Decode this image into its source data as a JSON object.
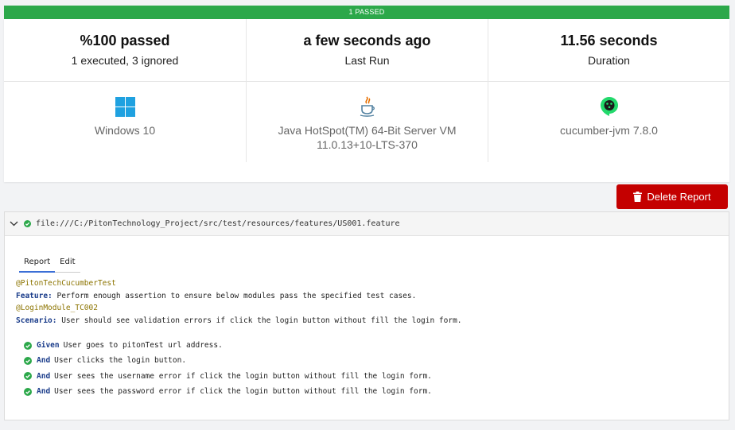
{
  "banner": {
    "text": "1 PASSED",
    "color": "#2ca84a"
  },
  "summary": {
    "passed": {
      "value": "%100 passed",
      "caption": "1 executed, 3 ignored"
    },
    "last_run": {
      "value": "a few seconds ago",
      "caption": "Last Run"
    },
    "duration": {
      "value": "11.56 seconds",
      "caption": "Duration"
    }
  },
  "environment": {
    "os": {
      "icon": "windows-icon",
      "label": "Windows 10"
    },
    "java": {
      "icon": "java-icon",
      "line1": "Java HotSpot(TM) 64-Bit Server VM",
      "line2": "11.0.13+10-LTS-370"
    },
    "runner": {
      "icon": "cucumber-icon",
      "label": "cucumber-jvm 7.8.0"
    }
  },
  "actions": {
    "delete_label": "Delete Report",
    "delete_color": "#c40000"
  },
  "feature": {
    "path": "file:///C:/PitonTechnology_Project/src/test/resources/features/US001.feature",
    "tabs": [
      {
        "label": "Report"
      },
      {
        "label": "Edit"
      }
    ],
    "feature_tag": "@PitonTechCucumberTest",
    "feature_keyword": "Feature:",
    "feature_text": " Perform enough assertion to ensure below modules pass the specified test cases.",
    "scenario_tag": "@LoginModule_TC002",
    "scenario_keyword": "Scenario:",
    "scenario_text": " User should see validation errors if click the login button without fill the login form.",
    "steps": [
      {
        "keyword": "Given",
        "text": "User goes to pitonTest url address."
      },
      {
        "keyword": "And",
        "text": "User clicks the login button."
      },
      {
        "keyword": "And",
        "text": "User sees the username error if click the login button without fill the login form."
      },
      {
        "keyword": "And",
        "text": "User sees the password error if click the login button without fill the login form."
      }
    ]
  }
}
